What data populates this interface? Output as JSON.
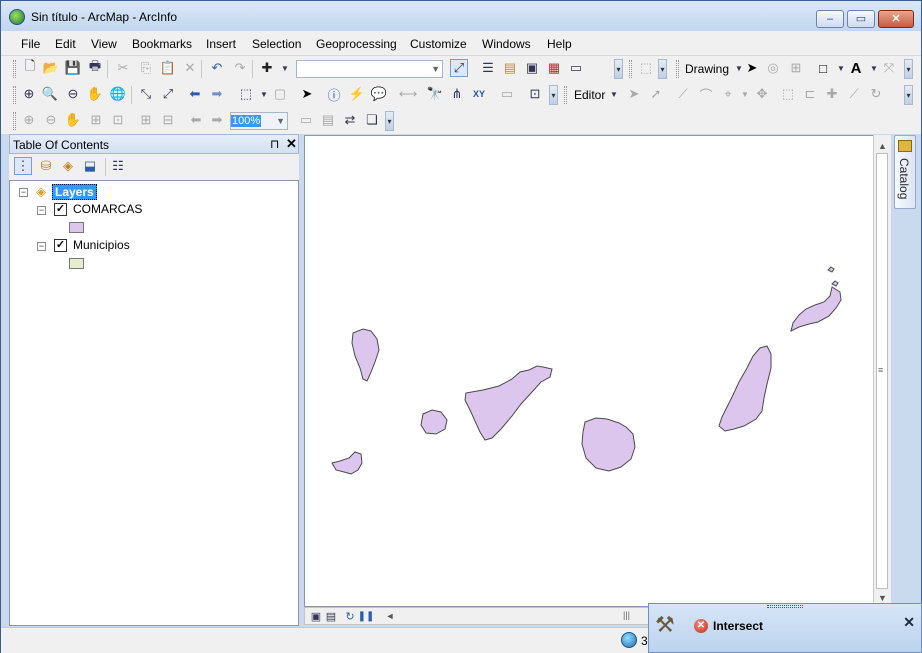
{
  "window": {
    "title": "Sin título - ArcMap - ArcInfo"
  },
  "menu": [
    "File",
    "Edit",
    "View",
    "Bookmarks",
    "Insert",
    "Selection",
    "Geoprocessing",
    "Customize",
    "Windows",
    "Help"
  ],
  "toolbars": {
    "drawing_label": "Drawing",
    "editor_label": "Editor",
    "zoom_value": "100%",
    "scale_value": ""
  },
  "toc": {
    "title": "Table Of Contents",
    "root_label": "Layers",
    "layers": [
      {
        "name": "COMARCAS",
        "checked": true,
        "swatch_color": "#dcc6ee"
      },
      {
        "name": "Municipios",
        "checked": true,
        "swatch_color": "#e3efcc"
      }
    ]
  },
  "map": {
    "polygon_fill": "#dcc6ee",
    "polygon_stroke": "#4a4a4a"
  },
  "catalog_tab": "Catalog",
  "status": {
    "coords_prefix": "3"
  },
  "popup": {
    "title": "Intersect",
    "status": "error"
  }
}
